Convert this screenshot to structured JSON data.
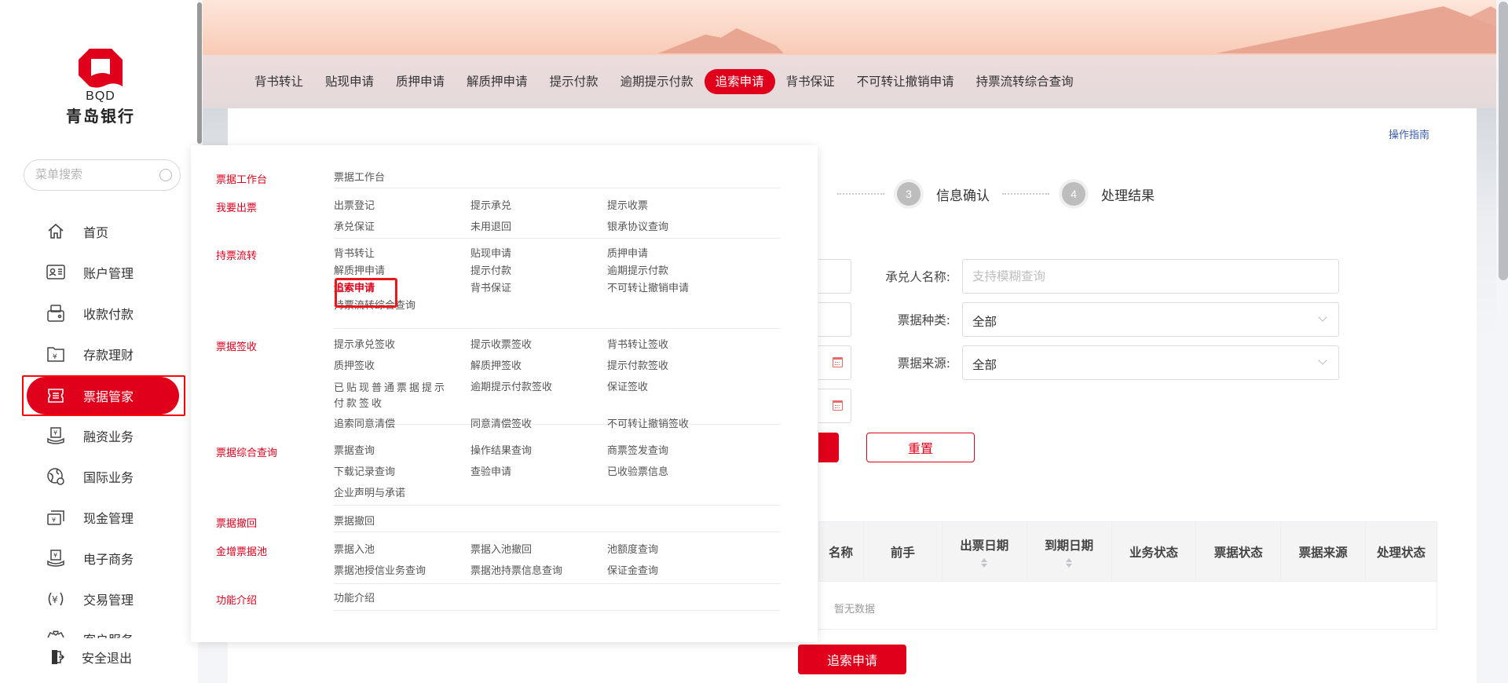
{
  "brand": {
    "logo_en": "BQD",
    "logo_cn": "青岛银行",
    "accent_color": "#e0001b"
  },
  "sidebar": {
    "search_placeholder": "菜单搜索",
    "items": [
      {
        "label": "首页",
        "icon": "home-icon"
      },
      {
        "label": "账户管理",
        "icon": "account-card-icon"
      },
      {
        "label": "收款付款",
        "icon": "wallet-icon"
      },
      {
        "label": "存款理财",
        "icon": "folder-yuan-icon"
      },
      {
        "label": "票据管家",
        "icon": "bill-icon",
        "active": true
      },
      {
        "label": "融资业务",
        "icon": "hand-yuan-icon"
      },
      {
        "label": "国际业务",
        "icon": "globe-icon"
      },
      {
        "label": "现金管理",
        "icon": "cash-icon"
      },
      {
        "label": "电子商务",
        "icon": "hand-yuan-icon"
      },
      {
        "label": "交易管理",
        "icon": "yuan-cycle-icon"
      },
      {
        "label": "客户服务",
        "icon": "customer-service-icon"
      }
    ],
    "logout_label": "安全退出"
  },
  "tabs": [
    {
      "label": "背书转让"
    },
    {
      "label": "贴现申请"
    },
    {
      "label": "质押申请"
    },
    {
      "label": "解质押申请"
    },
    {
      "label": "提示付款"
    },
    {
      "label": "逾期提示付款"
    },
    {
      "label": "追索申请",
      "active": true
    },
    {
      "label": "背书保证"
    },
    {
      "label": "不可转让撤销申请"
    },
    {
      "label": "持票流转综合查询"
    }
  ],
  "main": {
    "guide_link": "操作指南",
    "steps": [
      {
        "num": "3",
        "label": "信息确认"
      },
      {
        "num": "4",
        "label": "处理结果"
      }
    ],
    "form": {
      "acceptor_label": "承兑人名称:",
      "acceptor_placeholder": "支持模糊查询",
      "bill_type_label": "票据种类:",
      "bill_type_value": "全部",
      "bill_source_label": "票据来源:",
      "bill_source_value": "全部"
    },
    "reset_button": "重置",
    "table": {
      "columns": [
        "名称",
        "前手",
        "出票日期",
        "到期日期",
        "业务状态",
        "票据状态",
        "票据来源",
        "处理状态"
      ],
      "sortable": [
        false,
        false,
        true,
        true,
        false,
        false,
        false,
        false
      ],
      "empty_text": "暂无数据"
    },
    "submit_button": "追索申请"
  },
  "dropdown": {
    "groups": [
      {
        "category": "票据工作台",
        "items": [
          "票据工作台"
        ]
      },
      {
        "category": "我要出票",
        "items": [
          "出票登记",
          "提示承兑",
          "提示收票",
          "承兑保证",
          "未用退回",
          "银承协议查询"
        ]
      },
      {
        "category": "持票流转",
        "items": [
          "背书转让",
          "贴现申请",
          "质押申请",
          "解质押申请",
          "提示付款",
          "逾期提示付款",
          "追索申请",
          "背书保证",
          "不可转让撤销申请",
          "持票流转综合查询"
        ]
      },
      {
        "category": "票据签收",
        "items": [
          "提示承兑签收",
          "提示收票签收",
          "背书转让签收",
          "质押签收",
          "解质押签收",
          "提示付款签收",
          "已贴现普通票据提示付款签收",
          "逾期提示付款签收",
          "保证签收",
          "追索同意清偿",
          "同意清偿签收",
          "不可转让撤销签收"
        ]
      },
      {
        "category": "票据综合查询",
        "items": [
          "票据查询",
          "操作结果查询",
          "商票签发查询",
          "下载记录查询",
          "查验申请",
          "已收验票信息",
          "企业声明与承诺"
        ]
      },
      {
        "category": "票据撤回",
        "items": [
          "票据撤回"
        ]
      },
      {
        "category": "金增票据池",
        "items": [
          "票据入池",
          "票据入池撤回",
          "池额度查询",
          "票据池授信业务查询",
          "票据池持票信息查询",
          "保证金查询"
        ]
      },
      {
        "category": "功能介绍",
        "items": [
          "功能介绍"
        ]
      }
    ],
    "current_item": "追索申请"
  }
}
